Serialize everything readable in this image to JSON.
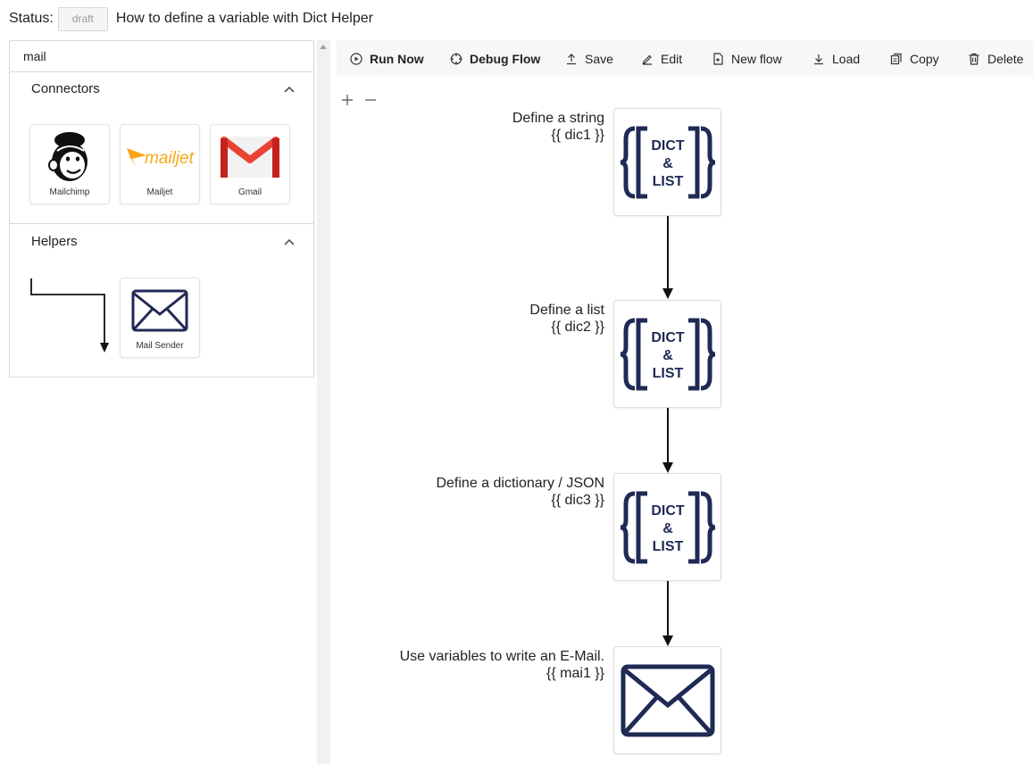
{
  "status": {
    "label": "Status:",
    "badge": "draft",
    "title": "How to define a variable with Dict Helper"
  },
  "search": {
    "value": "mail",
    "placeholder": ""
  },
  "sidebar": {
    "connectors": {
      "title": "Connectors",
      "items": [
        {
          "label": "Mailchimp",
          "icon": "mailchimp-logo"
        },
        {
          "label": "Mailjet",
          "icon": "mailjet-logo",
          "logo_text": "mailjet"
        },
        {
          "label": "Gmail",
          "icon": "gmail-logo"
        }
      ]
    },
    "helpers": {
      "title": "Helpers",
      "items": [
        {
          "label": "Mail Sender",
          "icon": "envelope-icon"
        }
      ]
    }
  },
  "toolbar": {
    "run_now": "Run Now",
    "debug_flow": "Debug Flow",
    "save": "Save",
    "edit": "Edit",
    "new_flow": "New flow",
    "load": "Load",
    "copy": "Copy",
    "delete": "Delete"
  },
  "flow": {
    "dict_logo_text": {
      "line1": "DICT",
      "line2": "&",
      "line3": "LIST"
    },
    "nodes": [
      {
        "title": "Define a string",
        "var": "{{ dic1 }}",
        "type": "dict-list"
      },
      {
        "title": "Define a list",
        "var": "{{ dic2 }}",
        "type": "dict-list"
      },
      {
        "title": "Define a dictionary / JSON",
        "var": "{{ dic3 }}",
        "type": "dict-list"
      },
      {
        "title": "Use variables to write an E-Mail.",
        "var": "{{ mai1 }}",
        "type": "mail-sender"
      }
    ]
  },
  "colors": {
    "navy": "#1f2a55",
    "gmail_red": "#ea4335",
    "mailjet_orange": "#f9a61a",
    "toolbar_bg": "#f7f7f7"
  }
}
